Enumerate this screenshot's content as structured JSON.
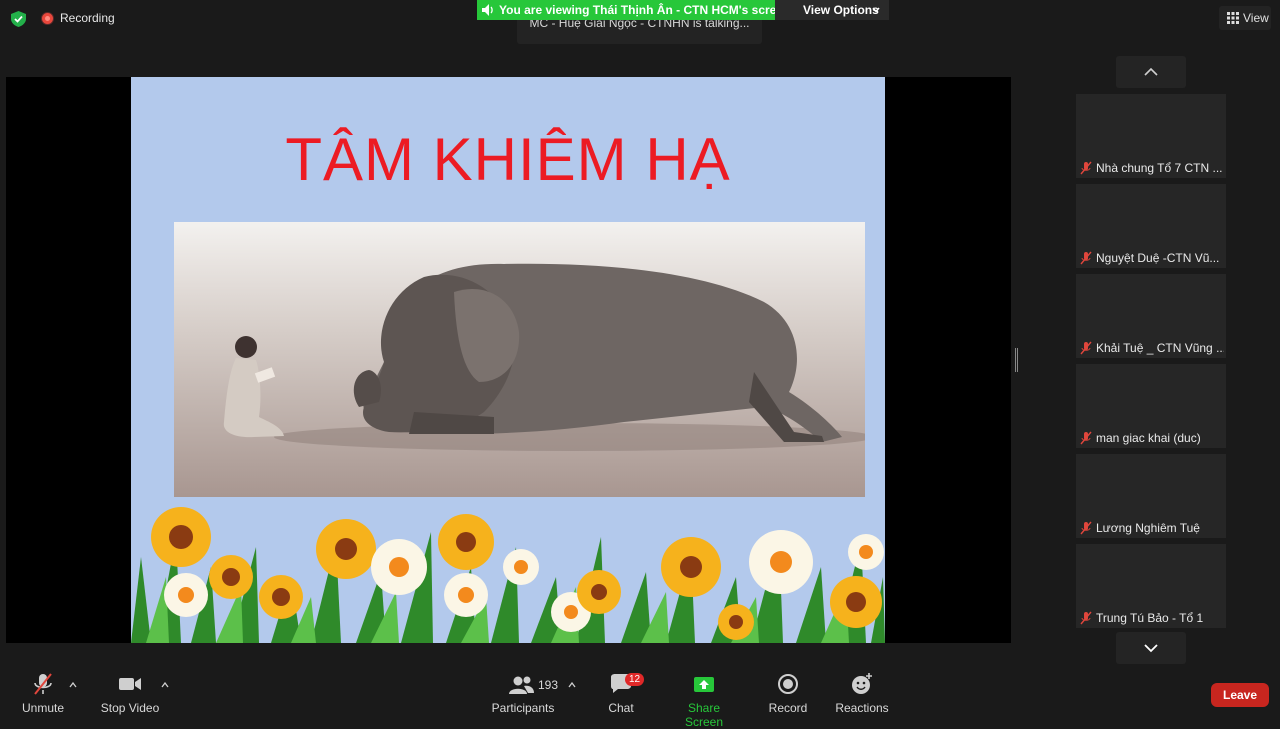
{
  "top": {
    "recording_label": "Recording",
    "viewing_banner": "You are viewing Thái Thịnh Ân - CTN HCM's screen",
    "talking_text": "MC - Huệ Giải Ngọc - CTNHN is talking...",
    "view_options_label": "View Options",
    "view_label": "View"
  },
  "slide": {
    "title": "TÂM KHIÊM HẠ"
  },
  "participants": [
    {
      "name": "Nhà chung Tổ 7 CTN ..."
    },
    {
      "name": "Nguyệt Duệ -CTN Vũ..."
    },
    {
      "name": "Khải Tuệ _ CTN Vũng ..."
    },
    {
      "name": "man giac khai (duc)"
    },
    {
      "name": "Lương Nghiêm Tuệ"
    },
    {
      "name": "Trung Tú Bảo - Tổ 1"
    }
  ],
  "toolbar": {
    "unmute": "Unmute",
    "stop_video": "Stop Video",
    "participants": "Participants",
    "participant_count": "193",
    "chat": "Chat",
    "chat_badge": "12",
    "share_screen": "Share Screen",
    "record": "Record",
    "reactions": "Reactions",
    "leave": "Leave"
  },
  "colors": {
    "share_green": "#27c73a",
    "leave_red": "#c8261f",
    "title_red": "#ec1b23",
    "slide_bg": "#b3c9ec"
  }
}
